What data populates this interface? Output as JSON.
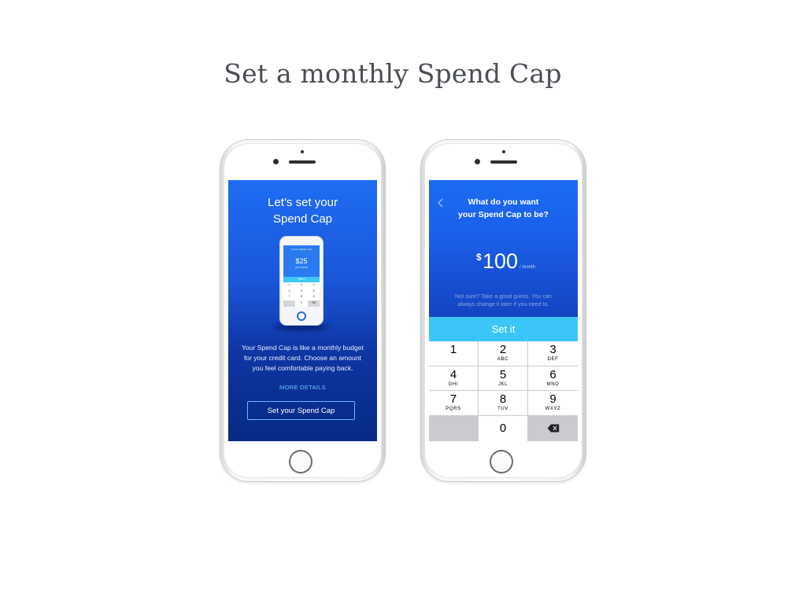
{
  "slide": {
    "title": "Set a monthly Spend Cap"
  },
  "intro_screen": {
    "heading_line1": "Let’s set your",
    "heading_line2": "Spend Cap",
    "illustration": {
      "caption": "YOUR SPEND CAP",
      "amount": "$25",
      "unit": "per month",
      "button": "Set it",
      "keys": [
        "1",
        "2",
        "3",
        "4",
        "5",
        "6",
        "7",
        "8",
        "9",
        "",
        "0",
        "⌫"
      ]
    },
    "body_line1": "Your Spend Cap is like a monthly budget",
    "body_line2": "for your credit card. Choose an amount",
    "body_line3": "you feel comfortable paying back.",
    "more_link": "MORE DETAILS",
    "cta_label": "Set your Spend Cap"
  },
  "amount_screen": {
    "question_line1": "What do you want",
    "question_line2": "your Spend Cap to be?",
    "currency_symbol": "$",
    "amount": "100",
    "period": "/ month",
    "hint_line1": "Not sure? Take a good guess. You can",
    "hint_line2": "always change it later if you need to.",
    "set_button": "Set it",
    "keys": [
      {
        "digit": "1",
        "letters": ""
      },
      {
        "digit": "2",
        "letters": "ABC"
      },
      {
        "digit": "3",
        "letters": "DEF"
      },
      {
        "digit": "4",
        "letters": "GHI"
      },
      {
        "digit": "5",
        "letters": "JKL"
      },
      {
        "digit": "6",
        "letters": "MNO"
      },
      {
        "digit": "7",
        "letters": "PQRS"
      },
      {
        "digit": "8",
        "letters": "TUV"
      },
      {
        "digit": "9",
        "letters": "WXYZ"
      },
      {
        "digit": "",
        "letters": ""
      },
      {
        "digit": "0",
        "letters": ""
      },
      {
        "digit": "",
        "letters": ""
      }
    ]
  },
  "colors": {
    "brand_blue": "#1a5fe8",
    "set_button": "#3cc6f8",
    "link": "#6fc6ff",
    "title_text": "#4a4e54"
  },
  "icons": [
    "back-chevron-icon",
    "backspace-icon",
    "home-button-icon"
  ]
}
